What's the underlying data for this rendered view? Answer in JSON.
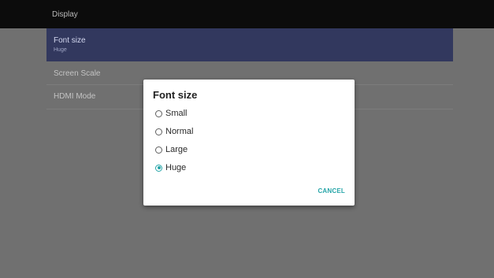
{
  "header": {
    "title": "Display"
  },
  "preferences": [
    {
      "title": "Font size",
      "summary": "Huge"
    },
    {
      "title": "Screen Scale"
    },
    {
      "title": "HDMI Mode"
    }
  ],
  "dialog": {
    "title": "Font size",
    "options": [
      {
        "label": "Small",
        "checked": false
      },
      {
        "label": "Normal",
        "checked": false
      },
      {
        "label": "Large",
        "checked": false
      },
      {
        "label": "Huge",
        "checked": true
      }
    ],
    "selected": "Huge",
    "cancel_label": "CANCEL"
  },
  "colors": {
    "accent": "#26a5a8",
    "selected_row": "#32385e",
    "header_bg": "#0c0c0c",
    "scrim": "#707070"
  }
}
